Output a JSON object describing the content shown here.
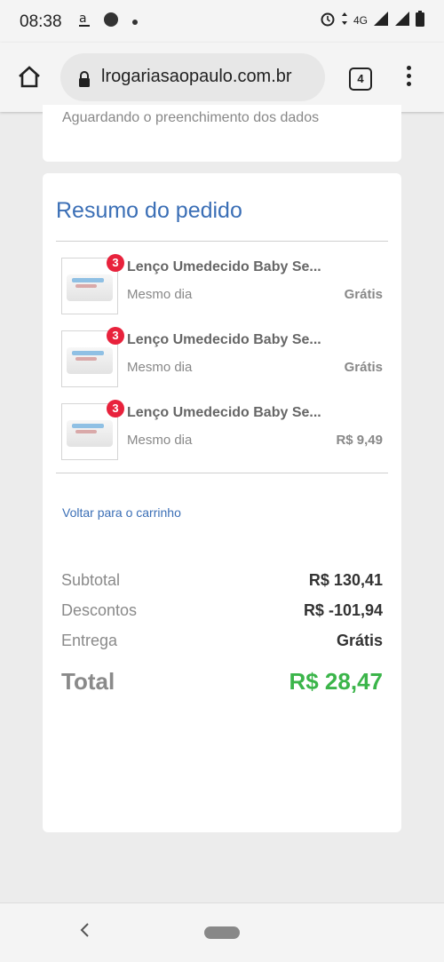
{
  "status_bar": {
    "time": "08:38",
    "network": "4G",
    "icons": [
      "amazon-icon",
      "notification-dot-icon",
      "alarm-icon",
      "data-arrows-icon",
      "signal-icon",
      "battery-icon"
    ]
  },
  "browser": {
    "url": "lrogariasaopaulo.com.br",
    "tab_count": "4"
  },
  "prev_section": {
    "status_text": "Aguardando o preenchimento dos dados"
  },
  "summary": {
    "title": "Resumo do pedido",
    "items": [
      {
        "qty": "3",
        "name": "Lenço Umedecido Baby Se...",
        "shipping": "Mesmo dia",
        "price": "Grátis"
      },
      {
        "qty": "3",
        "name": "Lenço Umedecido Baby Se...",
        "shipping": "Mesmo dia",
        "price": "Grátis"
      },
      {
        "qty": "3",
        "name": "Lenço Umedecido Baby Se...",
        "shipping": "Mesmo dia",
        "price": "R$ 9,49"
      }
    ],
    "back_link": "Voltar para o carrinho",
    "subtotal_label": "Subtotal",
    "subtotal_value": "R$ 130,41",
    "discount_label": "Descontos",
    "discount_value": "R$ -101,94",
    "delivery_label": "Entrega",
    "delivery_value": "Grátis",
    "total_label": "Total",
    "total_value": "R$ 28,47"
  },
  "colors": {
    "accent_blue": "#3b6fb6",
    "total_green": "#3bb54a",
    "badge_red": "#e8223c"
  }
}
